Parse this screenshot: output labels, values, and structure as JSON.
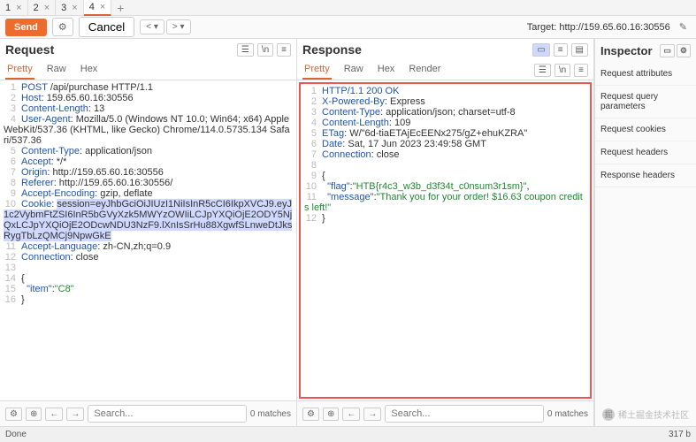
{
  "tabs": {
    "items": [
      {
        "label": "1"
      },
      {
        "label": "2"
      },
      {
        "label": "3"
      },
      {
        "label": "4"
      }
    ],
    "active": 3
  },
  "toolbar": {
    "send": "Send",
    "cancel": "Cancel",
    "back": "< ▾",
    "fwd": "> ▾",
    "target_label": "Target: http://159.65.60.16:30556"
  },
  "request": {
    "title": "Request",
    "subtabs": [
      "Pretty",
      "Raw",
      "Hex"
    ],
    "lines": [
      [
        {
          "t": "POST",
          "c": "kw"
        },
        {
          "t": " /api/purchase HTTP/1.1"
        }
      ],
      [
        {
          "t": "Host",
          "c": "kw"
        },
        {
          "t": ": 159.65.60.16:30556"
        }
      ],
      [
        {
          "t": "Content-Length",
          "c": "kw"
        },
        {
          "t": ": 13"
        }
      ],
      [
        {
          "t": "User-Agent",
          "c": "kw"
        },
        {
          "t": ": Mozilla/5.0 (Windows NT 10.0; Win64; x64) AppleWebKit/537.36 (KHTML, like Gecko) Chrome/114.0.5735.134 Safari/537.36"
        }
      ],
      [
        {
          "t": "Content-Type",
          "c": "kw"
        },
        {
          "t": ": application/json"
        }
      ],
      [
        {
          "t": "Accept",
          "c": "kw"
        },
        {
          "t": ": */*"
        }
      ],
      [
        {
          "t": "Origin",
          "c": "kw"
        },
        {
          "t": ": http://159.65.60.16:30556"
        }
      ],
      [
        {
          "t": "Referer",
          "c": "kw"
        },
        {
          "t": ": http://159.65.60.16:30556/"
        }
      ],
      [
        {
          "t": "Accept-Encoding",
          "c": "kw"
        },
        {
          "t": ": gzip, deflate"
        }
      ],
      [
        {
          "t": "Cookie",
          "c": "kw"
        },
        {
          "t": ": "
        },
        {
          "t": "session=eyJhbGciOiJIUzI1NiIsInR5cCI6IkpXVCJ9.eyJ1c2VybmFtZSI6InR5bGVyXzk5MWYzOWIiLCJpYXQiOjE2ODY5NjQxLCJpYXQiOjE2ODcwNDU3NzF9.lXnIsSrHu88XgwfSLnweDtJksRygTbLzQMCj9NpwGkE",
          "c": "hlsel"
        }
      ],
      [
        {
          "t": "Accept-Language",
          "c": "kw"
        },
        {
          "t": ": zh-CN,zh;q=0.9"
        }
      ],
      [
        {
          "t": "Connection",
          "c": "kw"
        },
        {
          "t": ": close"
        }
      ],
      [
        {
          "t": ""
        }
      ],
      [
        {
          "t": "{"
        }
      ],
      [
        {
          "t": "  "
        },
        {
          "t": "\"item\"",
          "c": "kw"
        },
        {
          "t": ":"
        },
        {
          "t": "\"C8\"",
          "c": "strg"
        }
      ],
      [
        {
          "t": "}"
        }
      ]
    ]
  },
  "response": {
    "title": "Response",
    "subtabs": [
      "Pretty",
      "Raw",
      "Hex",
      "Render"
    ],
    "lines": [
      [
        {
          "t": "HTTP/1.1 200 OK",
          "c": "kw"
        }
      ],
      [
        {
          "t": "X-Powered-By",
          "c": "kw"
        },
        {
          "t": ": Express"
        }
      ],
      [
        {
          "t": "Content-Type",
          "c": "kw"
        },
        {
          "t": ": application/json; charset=utf-8"
        }
      ],
      [
        {
          "t": "Content-Length",
          "c": "kw"
        },
        {
          "t": ": 109"
        }
      ],
      [
        {
          "t": "ETag",
          "c": "kw"
        },
        {
          "t": ": W/\"6d-tiaETAjEcEENx275/gZ+ehuKZRA\""
        }
      ],
      [
        {
          "t": "Date",
          "c": "kw"
        },
        {
          "t": ": Sat, 17 Jun 2023 23:49:58 GMT"
        }
      ],
      [
        {
          "t": "Connection",
          "c": "kw"
        },
        {
          "t": ": close"
        }
      ],
      [
        {
          "t": ""
        }
      ],
      [
        {
          "t": "{"
        }
      ],
      [
        {
          "t": "  "
        },
        {
          "t": "\"flag\"",
          "c": "kw"
        },
        {
          "t": ":"
        },
        {
          "t": "\"HTB{r4c3_w3b_d3f34t_c0nsum3r1sm}\"",
          "c": "strg"
        },
        {
          "t": ","
        }
      ],
      [
        {
          "t": "  "
        },
        {
          "t": "\"message\"",
          "c": "kw"
        },
        {
          "t": ":"
        },
        {
          "t": "\"Thank you for your order! $16.63 coupon credits left!\"",
          "c": "strg"
        }
      ],
      [
        {
          "t": "}"
        }
      ]
    ]
  },
  "inspector": {
    "title": "Inspector",
    "items": [
      "Request attributes",
      "Request query parameters",
      "Request cookies",
      "Request headers",
      "Response headers"
    ]
  },
  "search": {
    "placeholder": "Search...",
    "matches": "0 matches"
  },
  "status": {
    "left": "Done",
    "right": "317 b"
  },
  "watermark": "稀土掘金技术社区"
}
